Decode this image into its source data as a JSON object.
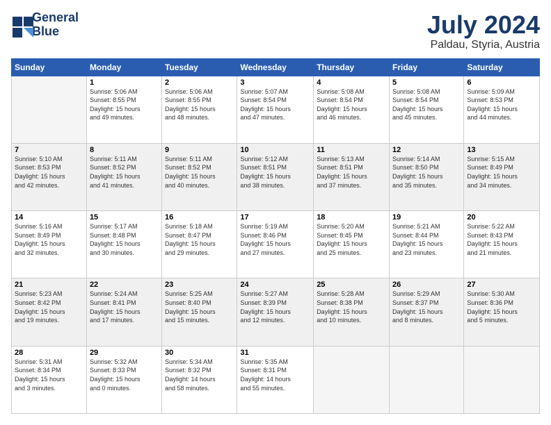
{
  "logo": {
    "line1": "General",
    "line2": "Blue"
  },
  "title": {
    "month": "July 2024",
    "location": "Paldau, Styria, Austria"
  },
  "weekdays": [
    "Sunday",
    "Monday",
    "Tuesday",
    "Wednesday",
    "Thursday",
    "Friday",
    "Saturday"
  ],
  "weeks": [
    [
      {
        "day": "",
        "info": ""
      },
      {
        "day": "1",
        "info": "Sunrise: 5:06 AM\nSunset: 8:55 PM\nDaylight: 15 hours\nand 49 minutes."
      },
      {
        "day": "2",
        "info": "Sunrise: 5:06 AM\nSunset: 8:55 PM\nDaylight: 15 hours\nand 48 minutes."
      },
      {
        "day": "3",
        "info": "Sunrise: 5:07 AM\nSunset: 8:54 PM\nDaylight: 15 hours\nand 47 minutes."
      },
      {
        "day": "4",
        "info": "Sunrise: 5:08 AM\nSunset: 8:54 PM\nDaylight: 15 hours\nand 46 minutes."
      },
      {
        "day": "5",
        "info": "Sunrise: 5:08 AM\nSunset: 8:54 PM\nDaylight: 15 hours\nand 45 minutes."
      },
      {
        "day": "6",
        "info": "Sunrise: 5:09 AM\nSunset: 8:53 PM\nDaylight: 15 hours\nand 44 minutes."
      }
    ],
    [
      {
        "day": "7",
        "info": "Sunrise: 5:10 AM\nSunset: 8:53 PM\nDaylight: 15 hours\nand 42 minutes."
      },
      {
        "day": "8",
        "info": "Sunrise: 5:11 AM\nSunset: 8:52 PM\nDaylight: 15 hours\nand 41 minutes."
      },
      {
        "day": "9",
        "info": "Sunrise: 5:11 AM\nSunset: 8:52 PM\nDaylight: 15 hours\nand 40 minutes."
      },
      {
        "day": "10",
        "info": "Sunrise: 5:12 AM\nSunset: 8:51 PM\nDaylight: 15 hours\nand 38 minutes."
      },
      {
        "day": "11",
        "info": "Sunrise: 5:13 AM\nSunset: 8:51 PM\nDaylight: 15 hours\nand 37 minutes."
      },
      {
        "day": "12",
        "info": "Sunrise: 5:14 AM\nSunset: 8:50 PM\nDaylight: 15 hours\nand 35 minutes."
      },
      {
        "day": "13",
        "info": "Sunrise: 5:15 AM\nSunset: 8:49 PM\nDaylight: 15 hours\nand 34 minutes."
      }
    ],
    [
      {
        "day": "14",
        "info": "Sunrise: 5:16 AM\nSunset: 8:49 PM\nDaylight: 15 hours\nand 32 minutes."
      },
      {
        "day": "15",
        "info": "Sunrise: 5:17 AM\nSunset: 8:48 PM\nDaylight: 15 hours\nand 30 minutes."
      },
      {
        "day": "16",
        "info": "Sunrise: 5:18 AM\nSunset: 8:47 PM\nDaylight: 15 hours\nand 29 minutes."
      },
      {
        "day": "17",
        "info": "Sunrise: 5:19 AM\nSunset: 8:46 PM\nDaylight: 15 hours\nand 27 minutes."
      },
      {
        "day": "18",
        "info": "Sunrise: 5:20 AM\nSunset: 8:45 PM\nDaylight: 15 hours\nand 25 minutes."
      },
      {
        "day": "19",
        "info": "Sunrise: 5:21 AM\nSunset: 8:44 PM\nDaylight: 15 hours\nand 23 minutes."
      },
      {
        "day": "20",
        "info": "Sunrise: 5:22 AM\nSunset: 8:43 PM\nDaylight: 15 hours\nand 21 minutes."
      }
    ],
    [
      {
        "day": "21",
        "info": "Sunrise: 5:23 AM\nSunset: 8:42 PM\nDaylight: 15 hours\nand 19 minutes."
      },
      {
        "day": "22",
        "info": "Sunrise: 5:24 AM\nSunset: 8:41 PM\nDaylight: 15 hours\nand 17 minutes."
      },
      {
        "day": "23",
        "info": "Sunrise: 5:25 AM\nSunset: 8:40 PM\nDaylight: 15 hours\nand 15 minutes."
      },
      {
        "day": "24",
        "info": "Sunrise: 5:27 AM\nSunset: 8:39 PM\nDaylight: 15 hours\nand 12 minutes."
      },
      {
        "day": "25",
        "info": "Sunrise: 5:28 AM\nSunset: 8:38 PM\nDaylight: 15 hours\nand 10 minutes."
      },
      {
        "day": "26",
        "info": "Sunrise: 5:29 AM\nSunset: 8:37 PM\nDaylight: 15 hours\nand 8 minutes."
      },
      {
        "day": "27",
        "info": "Sunrise: 5:30 AM\nSunset: 8:36 PM\nDaylight: 15 hours\nand 5 minutes."
      }
    ],
    [
      {
        "day": "28",
        "info": "Sunrise: 5:31 AM\nSunset: 8:34 PM\nDaylight: 15 hours\nand 3 minutes."
      },
      {
        "day": "29",
        "info": "Sunrise: 5:32 AM\nSunset: 8:33 PM\nDaylight: 15 hours\nand 0 minutes."
      },
      {
        "day": "30",
        "info": "Sunrise: 5:34 AM\nSunset: 8:32 PM\nDaylight: 14 hours\nand 58 minutes."
      },
      {
        "day": "31",
        "info": "Sunrise: 5:35 AM\nSunset: 8:31 PM\nDaylight: 14 hours\nand 55 minutes."
      },
      {
        "day": "",
        "info": ""
      },
      {
        "day": "",
        "info": ""
      },
      {
        "day": "",
        "info": ""
      }
    ]
  ]
}
